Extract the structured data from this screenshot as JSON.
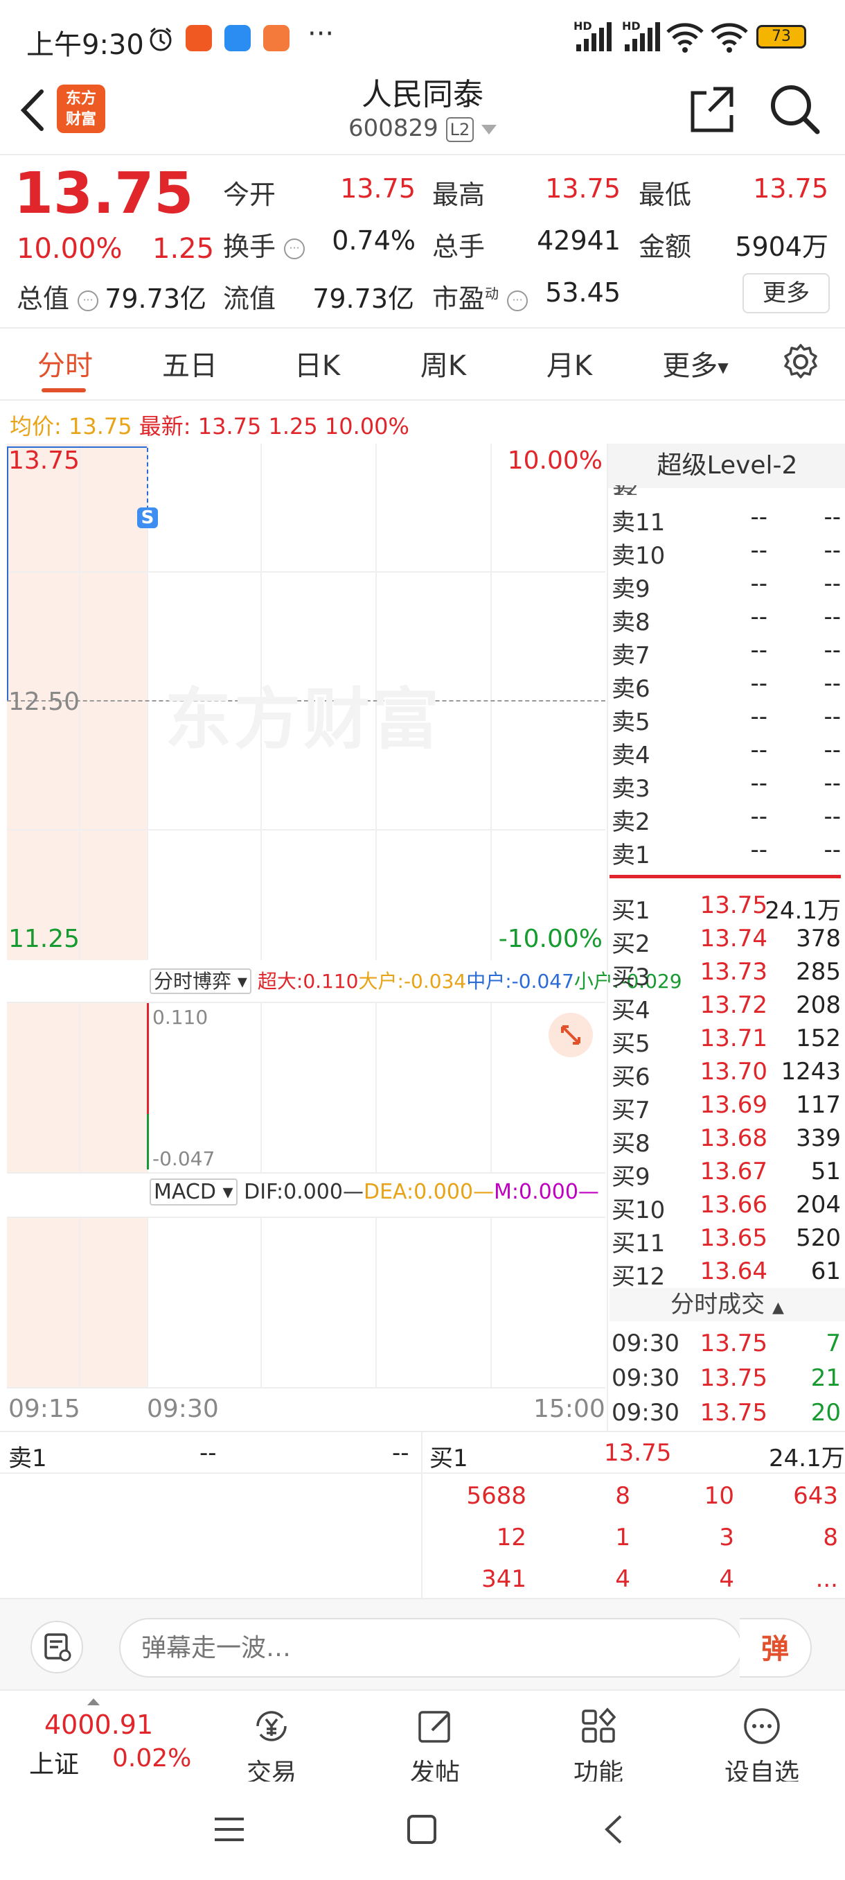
{
  "status_bar": {
    "time": "上午9:30",
    "more": "···",
    "net1": "HD",
    "net2": "HD",
    "battery": "73"
  },
  "header": {
    "title": "人民同泰",
    "code": "600829",
    "level_badge": "L2",
    "logo_line1": "东方",
    "logo_line2": "财富"
  },
  "quote": {
    "price": "13.75",
    "change_pct": "10.00%",
    "change": "1.25",
    "open_label": "今开",
    "open": "13.75",
    "high_label": "最高",
    "high": "13.75",
    "low_label": "最低",
    "low": "13.75",
    "turnover_label": "换手",
    "turnover": "0.74%",
    "volume_label": "总手",
    "volume": "42941",
    "amount_label": "金额",
    "amount": "5904万",
    "mktcap_label": "总值",
    "mktcap": "79.73亿",
    "float_label": "流值",
    "float_cap": "79.73亿",
    "pe_label": "市盈",
    "pe_sup": "动",
    "pe": "53.45",
    "more_button": "更多"
  },
  "tabs": [
    "分时",
    "五日",
    "日K",
    "周K",
    "月K",
    "更多"
  ],
  "info_line": {
    "avg_label": "均价:",
    "avg": "13.75",
    "latest_label": "最新:",
    "latest": "13.75",
    "chg": "1.25",
    "pct": "10.00%"
  },
  "chart": {
    "y_top": "13.75",
    "y_mid": "12.50",
    "y_bottom": "11.25",
    "pct_top": "10.00%",
    "pct_bottom": "-10.00%",
    "s_marker": "S",
    "watermark": "东方财富",
    "x_labels": [
      "09:15",
      "09:30",
      "15:00"
    ]
  },
  "fund_flow": {
    "selector": "分时博弈",
    "super_label": "超大:",
    "super": "0.110",
    "large_label": "大户:",
    "large": "-0.034",
    "medium_label": "中户:",
    "medium": "-0.047",
    "small_label": "小户:",
    "small": "-0.029",
    "axis_top": "0.110",
    "axis_bottom": "-0.047"
  },
  "macd": {
    "selector": "MACD",
    "dif_label": "DIF:",
    "dif": "0.000",
    "dea_label": "DEA:",
    "dea": "0.000",
    "m_label": "M:",
    "m": "0.000"
  },
  "orderbook": {
    "title": "超级Level-2",
    "sells": [
      {
        "label": "卖11",
        "price": "--",
        "vol": "--"
      },
      {
        "label": "卖10",
        "price": "--",
        "vol": "--"
      },
      {
        "label": "卖9",
        "price": "--",
        "vol": "--"
      },
      {
        "label": "卖8",
        "price": "--",
        "vol": "--"
      },
      {
        "label": "卖7",
        "price": "--",
        "vol": "--"
      },
      {
        "label": "卖6",
        "price": "--",
        "vol": "--"
      },
      {
        "label": "卖5",
        "price": "--",
        "vol": "--"
      },
      {
        "label": "卖4",
        "price": "--",
        "vol": "--"
      },
      {
        "label": "卖3",
        "price": "--",
        "vol": "--"
      },
      {
        "label": "卖2",
        "price": "--",
        "vol": "--"
      },
      {
        "label": "卖1",
        "price": "--",
        "vol": "--"
      }
    ],
    "buys": [
      {
        "label": "买1",
        "price": "13.75",
        "vol": "24.1万"
      },
      {
        "label": "买2",
        "price": "13.74",
        "vol": "378"
      },
      {
        "label": "买3",
        "price": "13.73",
        "vol": "285"
      },
      {
        "label": "买4",
        "price": "13.72",
        "vol": "208"
      },
      {
        "label": "买5",
        "price": "13.71",
        "vol": "152"
      },
      {
        "label": "买6",
        "price": "13.70",
        "vol": "1243"
      },
      {
        "label": "买7",
        "price": "13.69",
        "vol": "117"
      },
      {
        "label": "买8",
        "price": "13.68",
        "vol": "339"
      },
      {
        "label": "买9",
        "price": "13.67",
        "vol": "51"
      },
      {
        "label": "买10",
        "price": "13.66",
        "vol": "204"
      },
      {
        "label": "买11",
        "price": "13.65",
        "vol": "520"
      },
      {
        "label": "买12",
        "price": "13.64",
        "vol": "61"
      }
    ],
    "trades_title": "分时成交",
    "trades": [
      {
        "time": "09:30",
        "price": "13.75",
        "vol": "7"
      },
      {
        "time": "09:30",
        "price": "13.75",
        "vol": "21"
      },
      {
        "time": "09:30",
        "price": "13.75",
        "vol": "20"
      }
    ]
  },
  "queue": {
    "sell_label": "卖1",
    "sell_price": "--",
    "sell_vol": "--",
    "buy_label": "买1",
    "buy_price": "13.75",
    "buy_vol": "24.1万",
    "rows": [
      [
        "5688",
        "8",
        "10",
        "643"
      ],
      [
        "12",
        "1",
        "3",
        "8"
      ],
      [
        "341",
        "4",
        "4",
        "..."
      ]
    ]
  },
  "comment": {
    "placeholder": "弹幕走一波…",
    "danmu_label": "弹"
  },
  "bottom_bar": {
    "index_value": "4000.91",
    "index_name": "上证",
    "index_pct": "0.02%",
    "trade": "交易",
    "post": "发帖",
    "functions": "功能",
    "watchlist": "设自选"
  }
}
